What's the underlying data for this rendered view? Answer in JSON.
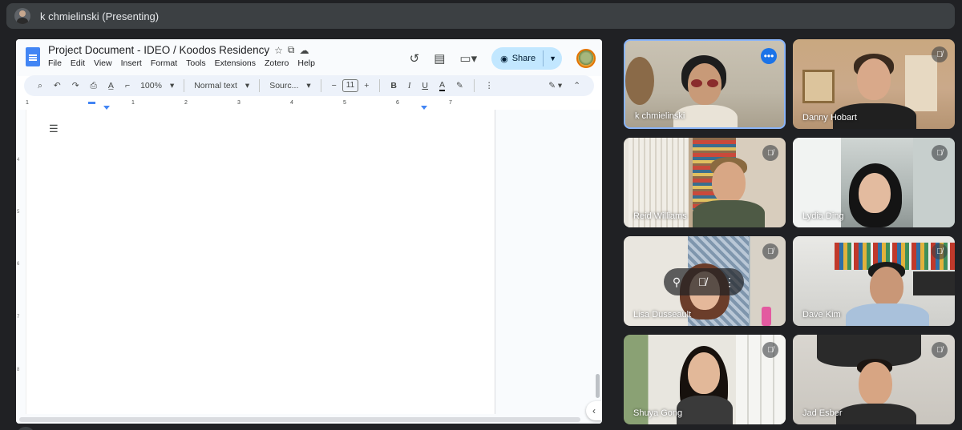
{
  "meeting": {
    "presenting_label": "k chmielinski (Presenting)"
  },
  "doc": {
    "title": "Project Document - IDEO / Koodos Residency",
    "menu": [
      "File",
      "Edit",
      "View",
      "Insert",
      "Format",
      "Tools",
      "Extensions",
      "Zotero",
      "Help"
    ],
    "share_label": "Share",
    "toolbar": {
      "zoom": "100%",
      "style": "Normal text",
      "font": "Sourc...",
      "font_size": "11"
    },
    "ruler_numbers": [
      "1",
      "1",
      "2",
      "3",
      "4",
      "5",
      "6",
      "7"
    ],
    "vruler_numbers": [
      "4",
      "5",
      "6",
      "7",
      "8"
    ]
  },
  "participants": [
    {
      "name": "k chmielinski",
      "muted": false,
      "active": true
    },
    {
      "name": "Danny Hobart",
      "muted": true,
      "active": false
    },
    {
      "name": "Reid Williams",
      "muted": true,
      "active": false
    },
    {
      "name": "Lydia Ding",
      "muted": true,
      "active": false
    },
    {
      "name": "Lisa Dusseault",
      "muted": true,
      "active": false
    },
    {
      "name": "Dave Kim",
      "muted": true,
      "active": false
    },
    {
      "name": "Shuya Gong",
      "muted": true,
      "active": false
    },
    {
      "name": "Jad Esber",
      "muted": true,
      "active": false
    }
  ],
  "colors": {
    "meet_bg": "#202124",
    "active_border": "#8ab4f8",
    "share_button": "#c2e7ff"
  }
}
